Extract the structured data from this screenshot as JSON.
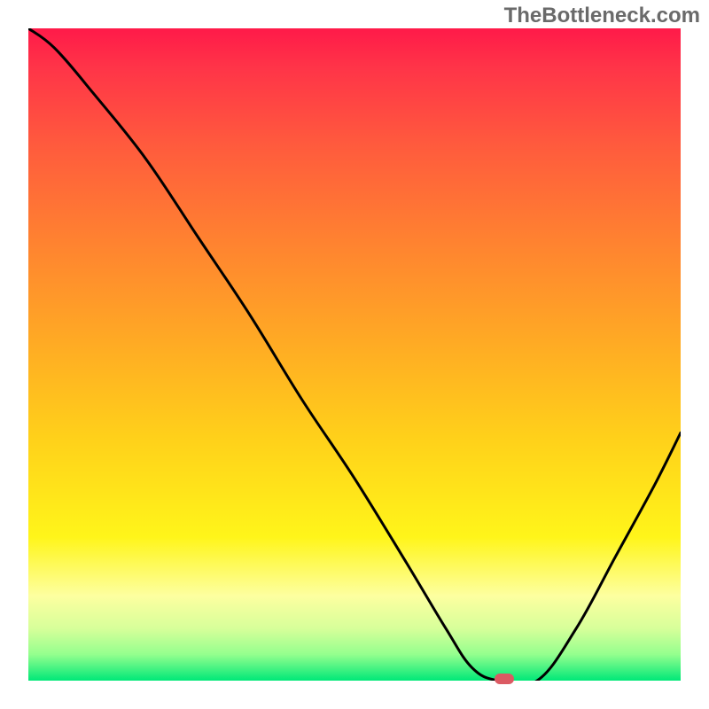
{
  "watermark": "TheBottleneck.com",
  "chart_data": {
    "type": "line",
    "title": "",
    "xlabel": "",
    "ylabel": "",
    "x": [
      0.0,
      0.04,
      0.1,
      0.18,
      0.26,
      0.34,
      0.42,
      0.5,
      0.58,
      0.64,
      0.68,
      0.72,
      0.78,
      0.84,
      0.9,
      0.96,
      1.0
    ],
    "values": [
      1.0,
      0.97,
      0.9,
      0.8,
      0.68,
      0.56,
      0.43,
      0.31,
      0.18,
      0.08,
      0.02,
      0.0,
      0.0,
      0.08,
      0.19,
      0.3,
      0.38
    ],
    "xlim": [
      0,
      1
    ],
    "ylim": [
      0,
      1
    ],
    "marker": {
      "x": 0.73,
      "y": 0.0
    }
  }
}
